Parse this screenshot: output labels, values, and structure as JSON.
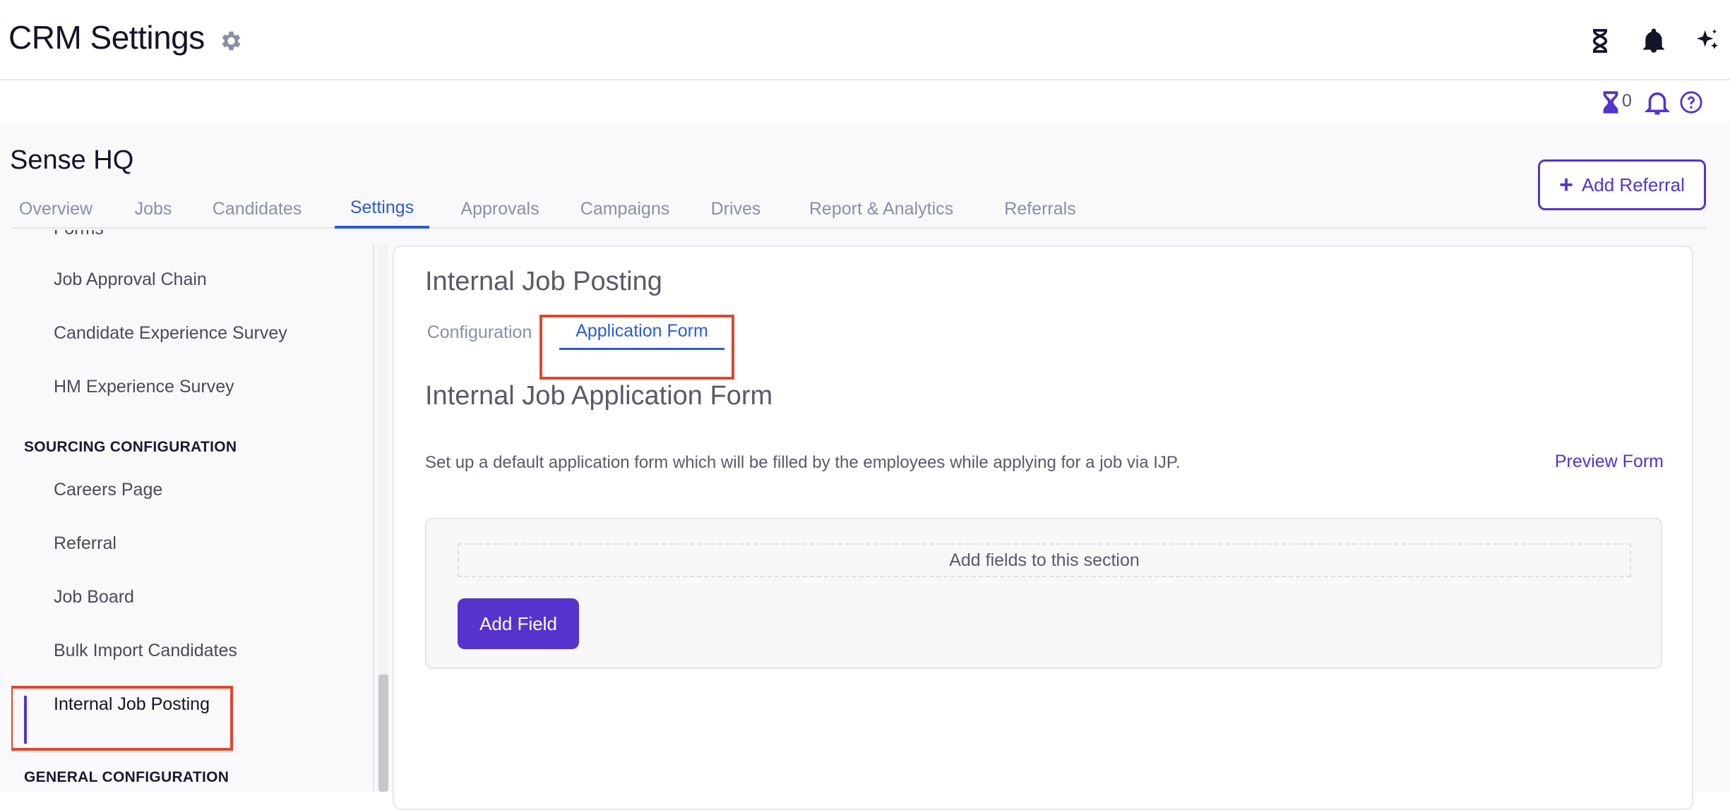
{
  "header": {
    "title": "CRM Settings",
    "icons": [
      "gear-icon",
      "hourglass-icon",
      "bell-icon",
      "sparkle-icon"
    ]
  },
  "utility": {
    "pending_count": "0",
    "icons": [
      "hourglass-icon",
      "bell-icon",
      "help-icon"
    ]
  },
  "org": {
    "name": "Sense HQ",
    "add_referral_label": "Add Referral"
  },
  "nav": {
    "tabs": [
      {
        "label": "Overview"
      },
      {
        "label": "Jobs"
      },
      {
        "label": "Candidates"
      },
      {
        "label": "Settings"
      },
      {
        "label": "Approvals"
      },
      {
        "label": "Campaigns"
      },
      {
        "label": "Drives"
      },
      {
        "label": "Report & Analytics"
      },
      {
        "label": "Referrals"
      }
    ],
    "active": "Settings"
  },
  "sidebar": {
    "items_top": [
      {
        "label": "Forms"
      },
      {
        "label": "Job Approval Chain"
      },
      {
        "label": "Candidate Experience Survey"
      },
      {
        "label": "HM Experience Survey"
      }
    ],
    "section_sourcing": "SOURCING CONFIGURATION",
    "items_sourcing": [
      {
        "label": "Careers Page"
      },
      {
        "label": "Referral"
      },
      {
        "label": "Job Board"
      },
      {
        "label": "Bulk Import Candidates"
      },
      {
        "label": "Internal Job Posting"
      }
    ],
    "section_general": "GENERAL CONFIGURATION",
    "active": "Internal Job Posting"
  },
  "content": {
    "title": "Internal Job Posting",
    "tabs": [
      {
        "label": "Configuration"
      },
      {
        "label": "Application Form"
      }
    ],
    "active_tab": "Application Form",
    "form_title": "Internal Job Application Form",
    "description": "Set up a default application form which will be filled by the employees while applying for a job via IJP.",
    "preview_label": "Preview Form",
    "section_placeholder": "Add fields to this section",
    "add_field_label": "Add Field"
  },
  "colors": {
    "accent": "#5533cc",
    "link_blue": "#2a5bd7",
    "highlight": "#e0472b"
  }
}
